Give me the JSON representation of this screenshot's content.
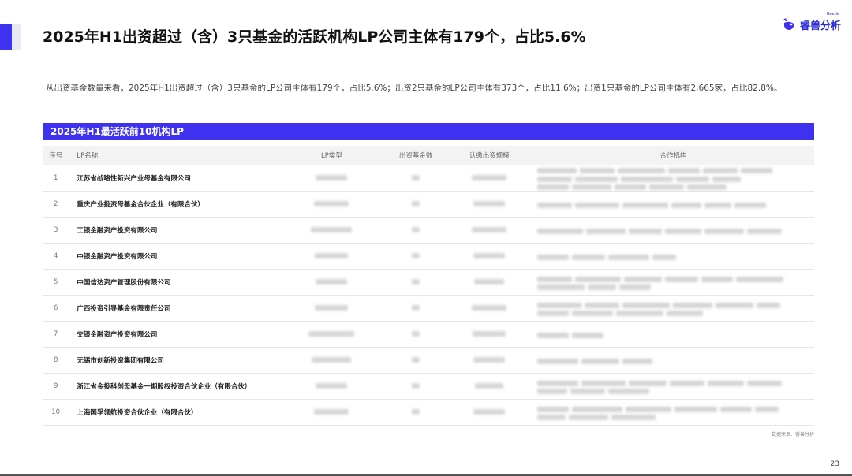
{
  "header": {
    "title": "2025年H1出资超过（含）3只基金的活跃机构LP公司主体有179个，占比5.6%",
    "logo_text": "睿兽分析",
    "logo_sub": "Beetle"
  },
  "summary": "从出资基金数量来看，2025年H1出资超过（含）3只基金的LP公司主体有179个，占比5.6%；出资2只基金的LP公司主体有373个，占比11.6%；出资1只基金的LP公司主体有2,665家，占比82.8%。",
  "table": {
    "title": "2025年H1最活跃前10机构LP",
    "columns": [
      "序号",
      "LP名称",
      "LP类型",
      "出资基金数",
      "认缴出资规模",
      "合作机构"
    ],
    "rows": [
      {
        "index": "1",
        "name": "江苏省战略性新兴产业母基金有限公司"
      },
      {
        "index": "2",
        "name": "重庆产业投资母基金合伙企业（有限合伙）"
      },
      {
        "index": "3",
        "name": "工银金融资产投资有限公司"
      },
      {
        "index": "4",
        "name": "中银金融资产投资有限公司"
      },
      {
        "index": "5",
        "name": "中国信达资产管理股份有限公司"
      },
      {
        "index": "6",
        "name": "广西投资引导基金有限责任公司"
      },
      {
        "index": "7",
        "name": "交银金融资产投资有限公司"
      },
      {
        "index": "8",
        "name": "无锡市创新投资集团有限公司"
      },
      {
        "index": "9",
        "name": "浙江省金投科创母基金一期股权投资合伙企业（有限合伙）"
      },
      {
        "index": "10",
        "name": "上海国孚领航投资合伙企业（有限合伙）"
      }
    ]
  },
  "source": "数据来源：睿兽分析",
  "page_number": "23",
  "colors": {
    "accent": "#3e32f0"
  }
}
